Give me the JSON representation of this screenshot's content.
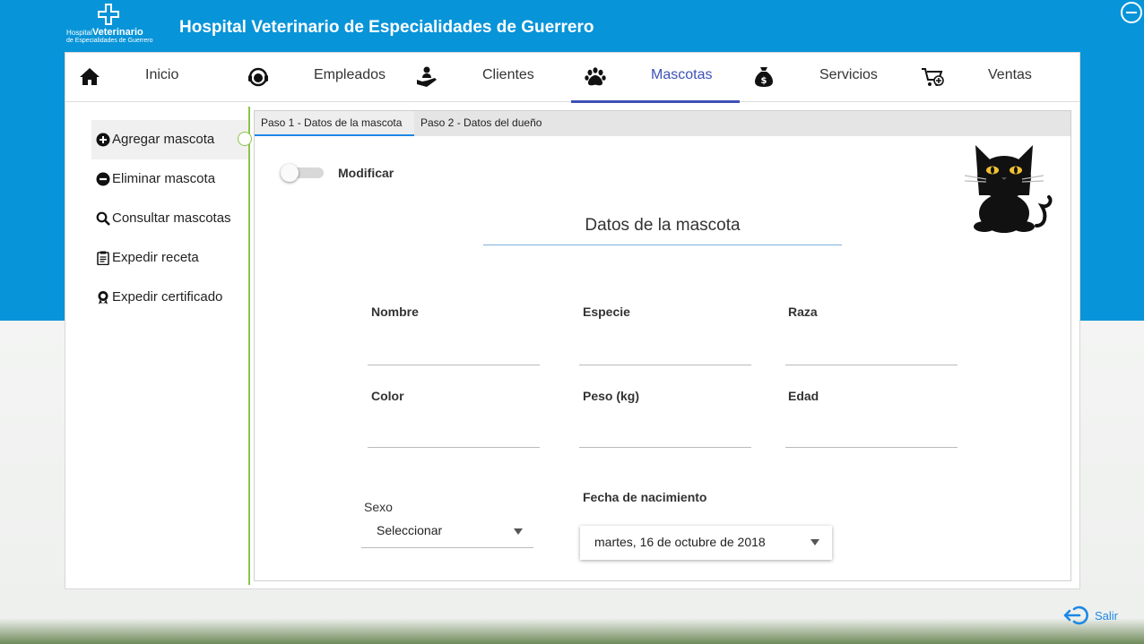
{
  "header": {
    "logo_line1_small": "Hospital",
    "logo_line1_bold": "Veterinario",
    "logo_line2": "de Especialidades de Guerrero",
    "title": "Hospital Veterinario de Especialidades de Guerrero",
    "minimize_icon": "minus-circle-icon"
  },
  "nav": {
    "items": [
      {
        "label": "Inicio",
        "icon": "home-icon"
      },
      {
        "label": "Empleados",
        "icon": "headset-icon"
      },
      {
        "label": "Clientes",
        "icon": "hand-user-icon"
      },
      {
        "label": "Mascotas",
        "icon": "paw-icon",
        "active": true
      },
      {
        "label": "Servicios",
        "icon": "money-bag-icon"
      },
      {
        "label": "Ventas",
        "icon": "cart-add-icon"
      }
    ],
    "active_color": "#3f51b5"
  },
  "sidebar": {
    "items": [
      {
        "label": "Agregar mascota",
        "icon": "plus-circle-icon",
        "active": true
      },
      {
        "label": "Eliminar mascota",
        "icon": "minus-circle-icon"
      },
      {
        "label": "Consultar mascotas",
        "icon": "search-icon"
      },
      {
        "label": "Expedir receta",
        "icon": "clipboard-icon"
      },
      {
        "label": "Expedir certificado",
        "icon": "award-icon"
      }
    ],
    "accent_color": "#8bc34a"
  },
  "tabs": [
    {
      "label": "Paso 1 -  Datos de la mascota",
      "active": true
    },
    {
      "label": "Paso 2 - Datos del dueño"
    }
  ],
  "form": {
    "toggle_label": "Modificar",
    "toggle_on": false,
    "section_title": "Datos de la mascota",
    "fields": {
      "nombre": {
        "label": "Nombre",
        "value": ""
      },
      "especie": {
        "label": "Especie",
        "value": ""
      },
      "raza": {
        "label": "Raza",
        "value": ""
      },
      "color": {
        "label": "Color",
        "value": ""
      },
      "peso": {
        "label": "Peso (kg)",
        "value": ""
      },
      "edad": {
        "label": "Edad",
        "value": ""
      }
    },
    "sexo": {
      "label": "Sexo",
      "value": "Seleccionar"
    },
    "fecha": {
      "label": "Fecha de nacimiento",
      "value": "martes, 16 de octubre de 2018"
    }
  },
  "footer": {
    "logout_label": "Salir",
    "logout_icon": "logout-icon"
  },
  "colors": {
    "header_blue": "#0894d8",
    "link_blue": "#1e88e5"
  }
}
